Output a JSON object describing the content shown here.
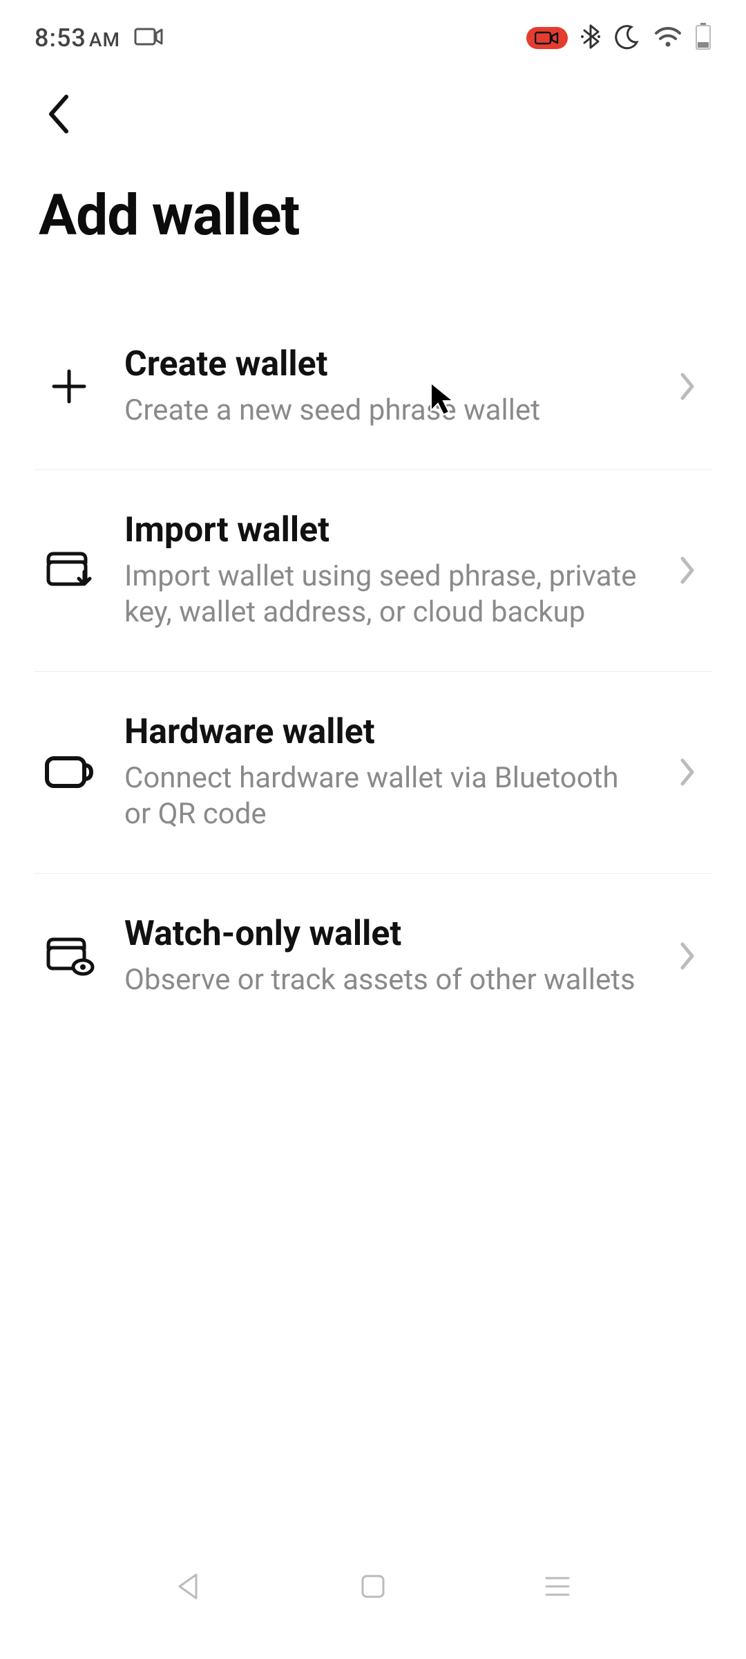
{
  "status": {
    "time": "8:53",
    "ampm": "AM"
  },
  "header": {
    "title": "Add wallet"
  },
  "options": [
    {
      "icon": "plus-icon",
      "title": "Create wallet",
      "desc": "Create a new seed phrase wallet"
    },
    {
      "icon": "wallet-import-icon",
      "title": "Import wallet",
      "desc": "Import wallet using seed phrase, private key, wallet address, or cloud backup"
    },
    {
      "icon": "hardware-wallet-icon",
      "title": "Hardware wallet",
      "desc": "Connect hardware wallet via Bluetooth or QR code"
    },
    {
      "icon": "watch-wallet-icon",
      "title": "Watch-only wallet",
      "desc": "Observe or track assets of other wallets"
    }
  ]
}
